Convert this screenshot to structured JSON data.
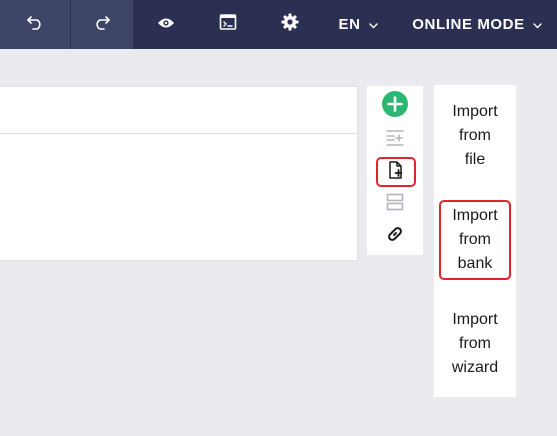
{
  "toolbar": {
    "undo_icon": "undo-icon",
    "redo_icon": "redo-icon",
    "preview_icon": "eye-icon",
    "template_icon": "template-icon",
    "settings_icon": "gear-icon",
    "language": "EN",
    "mode": "ONLINE MODE"
  },
  "tools": [
    {
      "name": "add-icon",
      "color": "#2bb673"
    },
    {
      "name": "insert-lines-icon"
    },
    {
      "name": "import-document-icon",
      "highlighted": true
    },
    {
      "name": "split-rows-icon"
    },
    {
      "name": "link-icon"
    }
  ],
  "imports": {
    "file": [
      "Import",
      "from",
      "file"
    ],
    "bank": [
      "Import",
      "from",
      "bank"
    ],
    "wizard": [
      "Import",
      "from",
      "wizard"
    ]
  },
  "colors": {
    "topbar": "#2b3052",
    "highlight": "#e0252d",
    "add_green": "#2bb673"
  }
}
